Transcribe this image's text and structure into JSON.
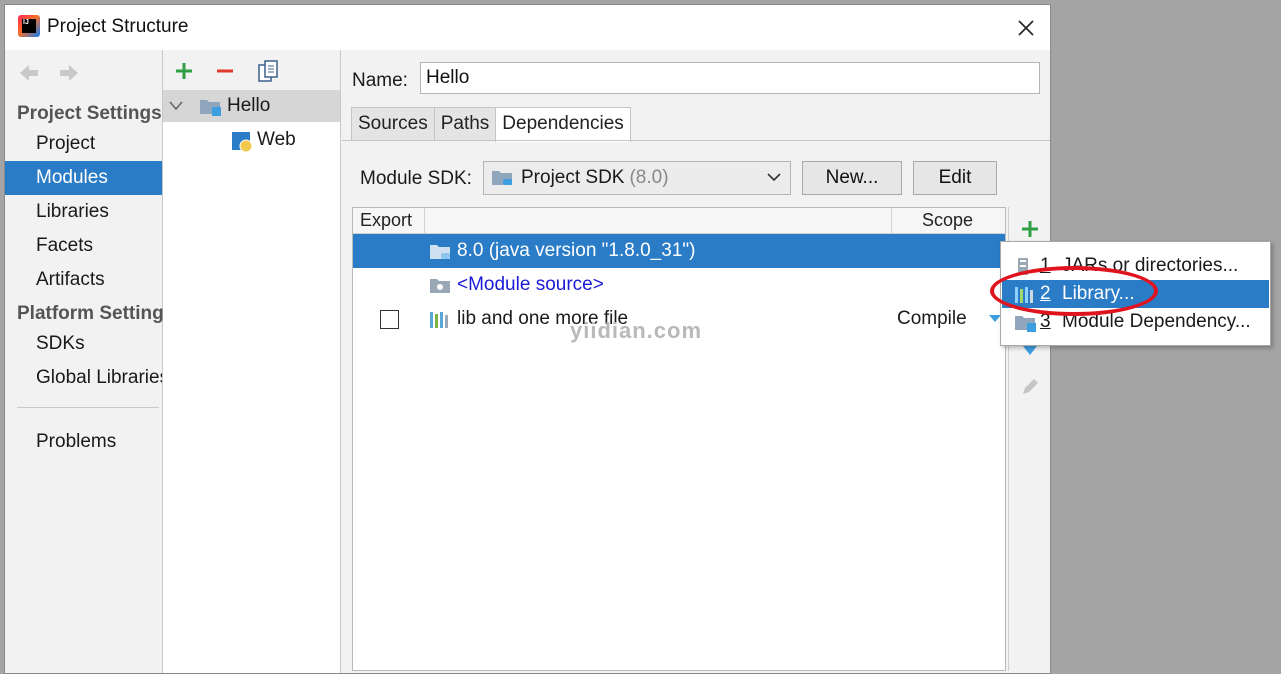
{
  "window": {
    "title": "Project Structure"
  },
  "sidebar": {
    "sections": [
      {
        "header": "Project Settings",
        "items": [
          "Project",
          "Modules",
          "Libraries",
          "Facets",
          "Artifacts"
        ]
      },
      {
        "header": "Platform Settings",
        "items": [
          "SDKs",
          "Global Libraries"
        ]
      }
    ],
    "selected": "Modules",
    "problems": "Problems"
  },
  "module_tree": {
    "root": "Hello",
    "children": [
      "Web"
    ]
  },
  "detail": {
    "name_label": "Name:",
    "name_value": "Hello",
    "tabs": [
      "Sources",
      "Paths",
      "Dependencies"
    ],
    "active_tab": "Dependencies",
    "sdk_label": "Module SDK:",
    "sdk_value": "Project SDK",
    "sdk_version": "(8.0)",
    "new_button": "New...",
    "edit_button": "Edit"
  },
  "dependencies": {
    "columns": [
      "Export",
      "Scope"
    ],
    "rows": [
      {
        "name": "8.0 (java version \"1.8.0_31\")",
        "selected": true
      },
      {
        "name": "<Module source>"
      },
      {
        "name": "lib and one more file",
        "scope": "Compile",
        "export": false
      }
    ]
  },
  "popup_menu": {
    "items": [
      {
        "num": "1",
        "label": "JARs or directories..."
      },
      {
        "num": "2",
        "label": "Library..."
      },
      {
        "num": "3",
        "label": "Module Dependency..."
      }
    ],
    "selected_index": 1
  },
  "watermark": "yiidian.com",
  "colors": {
    "selection": "#2a7cc7",
    "add": "#2ea043",
    "remove": "#e0392b",
    "annotation": "#e0141e"
  }
}
